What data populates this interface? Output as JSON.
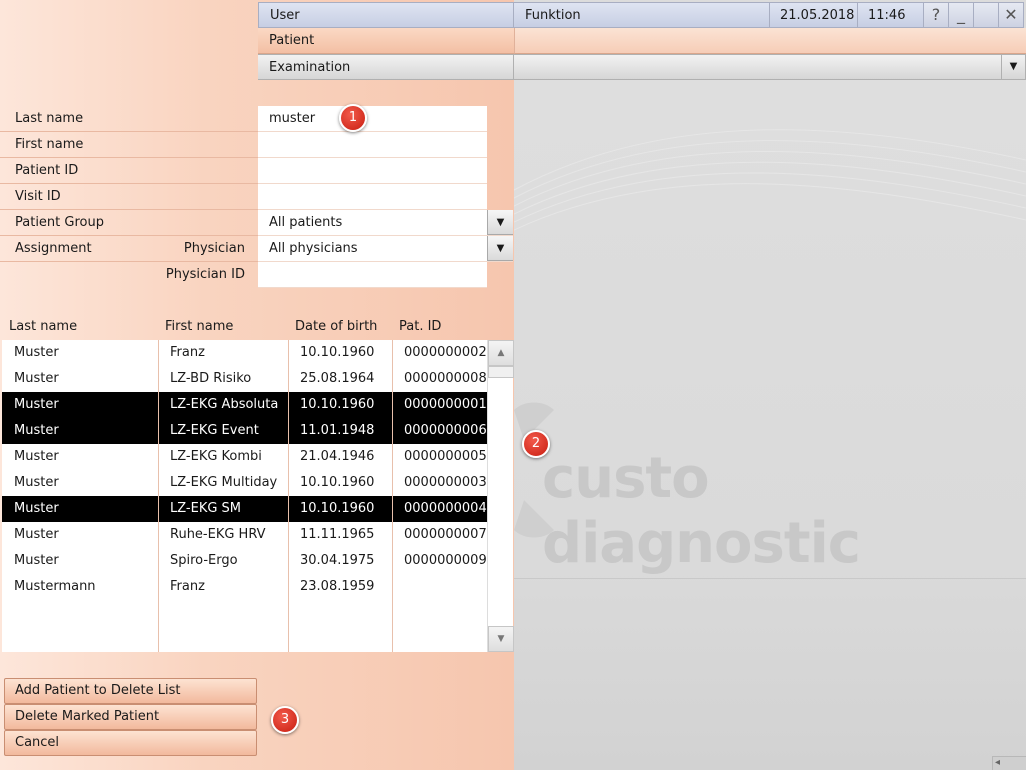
{
  "topbar": {
    "user": "User",
    "funktion": "Funktion",
    "date": "21.05.2018",
    "time": "11:46",
    "help_glyph": "?",
    "minimize_glyph": "_",
    "close_glyph": "✕"
  },
  "patient_bar": {
    "label": "Patient"
  },
  "examination_bar": {
    "label": "Examination",
    "dropdown_glyph": "▼"
  },
  "search": {
    "last_name": {
      "label": "Last name",
      "value": "muster"
    },
    "first_name": {
      "label": "First name",
      "value": ""
    },
    "patient_id": {
      "label": "Patient ID",
      "value": ""
    },
    "visit_id": {
      "label": "Visit ID",
      "value": ""
    },
    "patient_group": {
      "label": "Patient Group",
      "value": "All patients"
    },
    "assignment": {
      "label": "Assignment",
      "sublabel": "Physician",
      "value": "All physicians"
    },
    "physician_id": {
      "sublabel": "Physician ID",
      "value": ""
    }
  },
  "table": {
    "columns": [
      "Last name",
      "First name",
      "Date of birth",
      "Pat. ID"
    ],
    "rows": [
      {
        "last": "Muster",
        "first": "Franz",
        "dob": "10.10.1960",
        "id": "0000000002",
        "selected": false
      },
      {
        "last": "Muster",
        "first": "LZ-BD Risiko",
        "dob": "25.08.1964",
        "id": "0000000008",
        "selected": false
      },
      {
        "last": "Muster",
        "first": "LZ-EKG Absoluta",
        "dob": "10.10.1960",
        "id": "0000000001",
        "selected": true
      },
      {
        "last": "Muster",
        "first": "LZ-EKG Event",
        "dob": "11.01.1948",
        "id": "0000000006",
        "selected": true
      },
      {
        "last": "Muster",
        "first": "LZ-EKG Kombi",
        "dob": "21.04.1946",
        "id": "0000000005",
        "selected": false
      },
      {
        "last": "Muster",
        "first": "LZ-EKG Multiday",
        "dob": "10.10.1960",
        "id": "0000000003",
        "selected": false
      },
      {
        "last": "Muster",
        "first": "LZ-EKG SM",
        "dob": "10.10.1960",
        "id": "0000000004",
        "selected": true
      },
      {
        "last": "Muster",
        "first": "Ruhe-EKG HRV",
        "dob": "11.11.1965",
        "id": "0000000007",
        "selected": false
      },
      {
        "last": "Muster",
        "first": "Spiro-Ergo",
        "dob": "30.04.1975",
        "id": "0000000009",
        "selected": false
      },
      {
        "last": "Mustermann",
        "first": "Franz",
        "dob": "23.08.1959",
        "id": "",
        "selected": false
      }
    ]
  },
  "buttons": {
    "add": "Add Patient to Delete List",
    "delete": "Delete Marked Patient",
    "cancel": "Cancel"
  },
  "badges": {
    "one": "1",
    "two": "2",
    "three": "3"
  },
  "brand": "custo diagnostic",
  "colors": {
    "selected_row": "#000000",
    "badge": "#d9281a",
    "panel": "#f7caa e"
  }
}
